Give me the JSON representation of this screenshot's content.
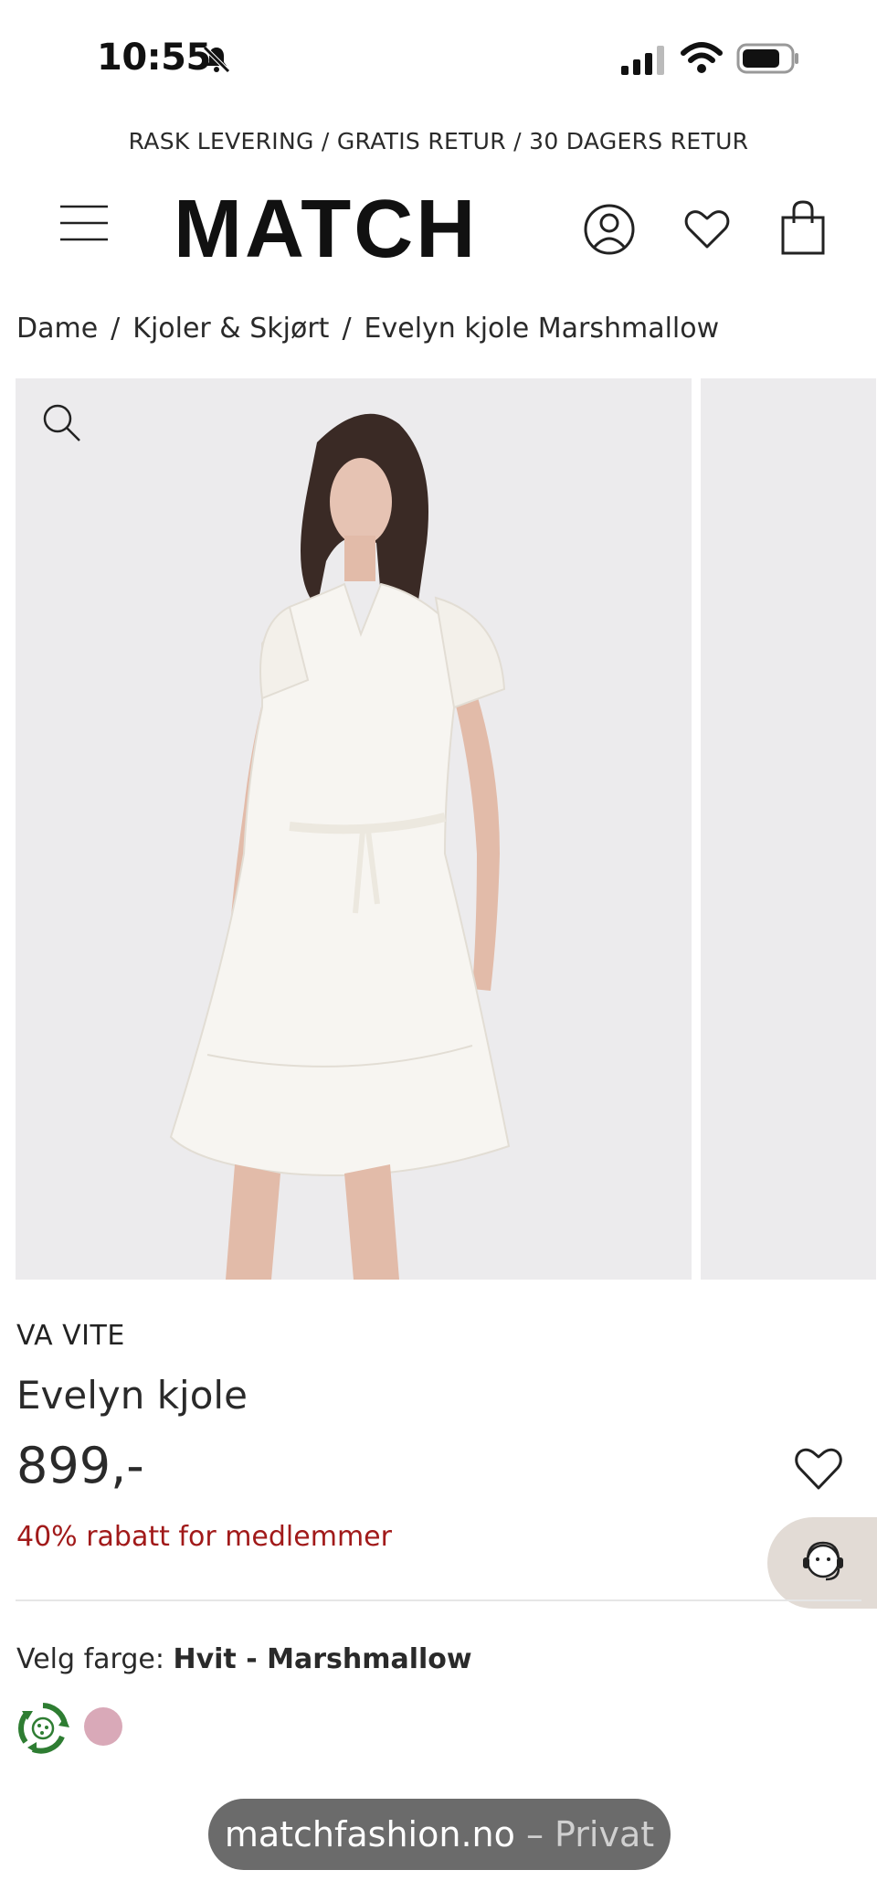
{
  "status_bar": {
    "time": "10:55"
  },
  "promo_banner": "RASK LEVERING / GRATIS RETUR / 30 DAGERS RETUR",
  "header": {
    "logo": "MATCH"
  },
  "breadcrumb": {
    "items": [
      "Dame",
      "Kjoler & Skjørt",
      "Evelyn kjole Marshmallow"
    ],
    "separator": "/"
  },
  "product": {
    "brand": "VA VITE",
    "name": "Evelyn kjole",
    "price": "899,-",
    "member_discount": "40% rabatt for medlemmer",
    "color_prefix": "Velg farge:",
    "color_selected": "Hvit - Marshmallow",
    "swatches": [
      {
        "name": "recycle-badge",
        "color": "#2e7d32"
      },
      {
        "name": "pink",
        "color": "#d9a9b8"
      }
    ]
  },
  "browser": {
    "domain": "matchfashion.no",
    "separator": "–",
    "mode": "Privat"
  },
  "colors": {
    "accent_red": "#a11a1a",
    "support_bg": "#e2dbd5",
    "image_bg": "#ecebed"
  }
}
